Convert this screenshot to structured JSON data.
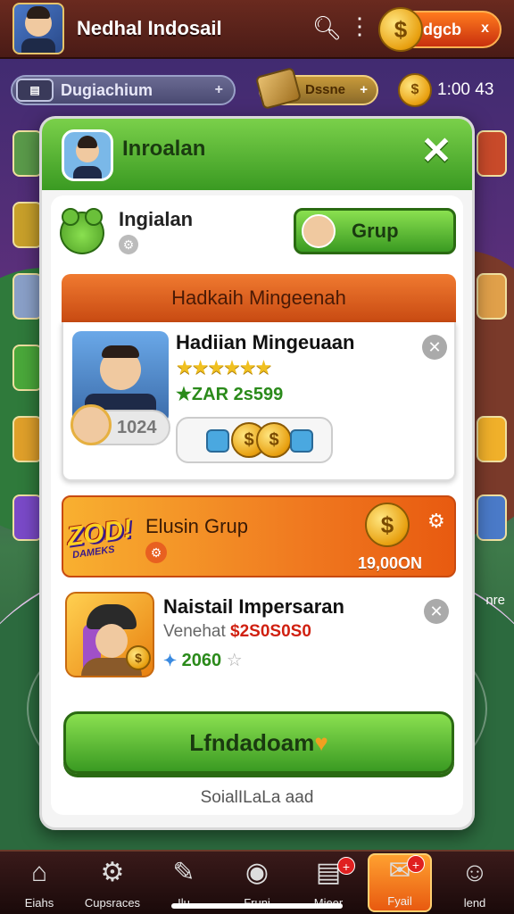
{
  "header": {
    "player_name": "Nedhal Indosail",
    "coin_label": "dgcb",
    "coin_symbol": "$",
    "close_glyph": "x"
  },
  "subbar": {
    "search_text": "Dugiachium",
    "search_plus": "+",
    "badge_text": "Dssne",
    "badge_plus": "+",
    "time_text": "1:00 43"
  },
  "modal": {
    "title": "Inroalan",
    "close_glyph": "✕",
    "profile": {
      "name": "Ingialan",
      "grup_button": "Grup"
    },
    "section_title": "Hadkaih Mingeenah",
    "card1": {
      "title": "Hadiian Mingeuaan",
      "stars": "★★★★★★",
      "stat": "★ZAR 2s599",
      "mini_value": "1024"
    },
    "banner": {
      "logo": "ZOD!",
      "logo_sub": "DAMEKS",
      "title": "Elusin Grup",
      "amount": "19,00ON"
    },
    "card2": {
      "title": "Naistail Impersaran",
      "sub_label": "Venehat",
      "price": "$2S0S0S0",
      "stat": "2060"
    },
    "main_button": "Lfndadoam",
    "footer": "SoialILaLa aad"
  },
  "bottomnav": {
    "items": [
      {
        "label": "Eiahs",
        "icon": "⌂"
      },
      {
        "label": "Cupsraces",
        "icon": "⚙"
      },
      {
        "label": "Ilu",
        "icon": "✎"
      },
      {
        "label": "Fruni",
        "icon": "◉"
      },
      {
        "label": "Mieer",
        "icon": "▤",
        "badge": "+"
      },
      {
        "label": "Fyail",
        "icon": "✉",
        "badge": "+"
      },
      {
        "label": "lend",
        "icon": "☺"
      }
    ]
  },
  "side_right_label": "nre",
  "colors": {
    "accent_green": "#3a9a22",
    "accent_orange": "#e85a10",
    "header_brown": "#4a1b16",
    "price_red": "#d02010"
  }
}
